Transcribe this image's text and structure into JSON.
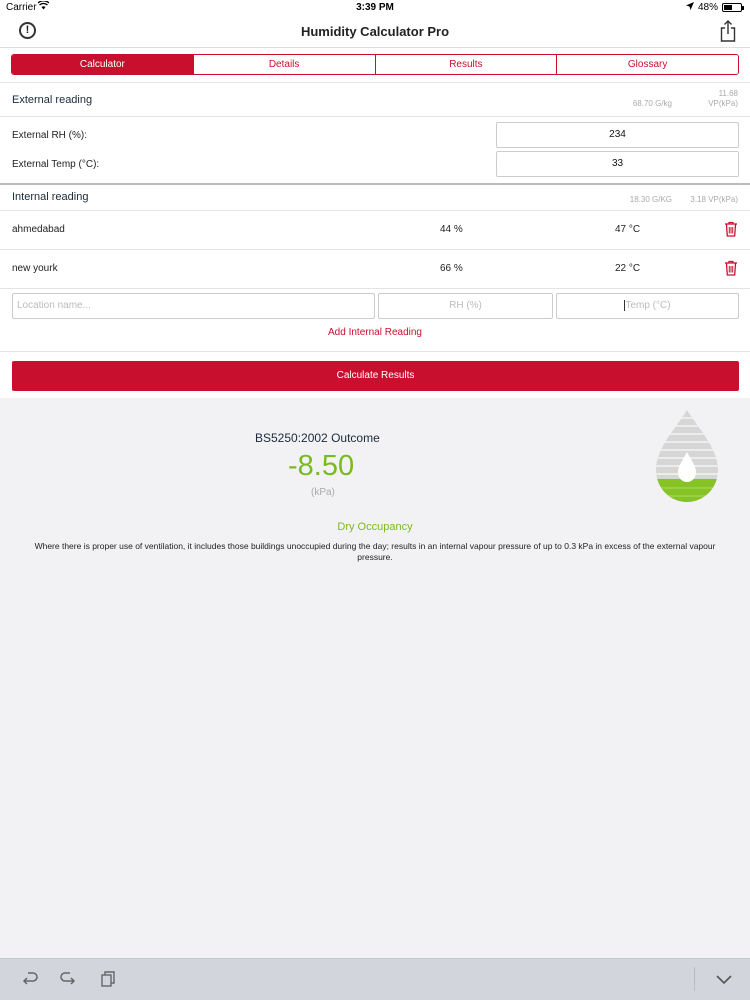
{
  "status_bar": {
    "carrier": "Carrier",
    "time": "3:39 PM",
    "battery": "48%",
    "battery_level": 0.48
  },
  "nav": {
    "title": "Humidity Calculator Pro",
    "info_icon": "info-icon",
    "share_icon": "share-icon"
  },
  "tabs": [
    {
      "label": "Calculator",
      "active": true
    },
    {
      "label": "Details",
      "active": false
    },
    {
      "label": "Results",
      "active": false
    },
    {
      "label": "Glossary",
      "active": false
    }
  ],
  "external": {
    "heading": "External reading",
    "gkg": "68.70 G/kg",
    "vp_value": "11.68",
    "vp_unit": "VP(kPa)",
    "rh_label": "External RH (%):",
    "rh_value": "234",
    "temp_label": "External Temp (°C):",
    "temp_value": "33"
  },
  "internal": {
    "heading": "Internal reading",
    "gkg": "18.30 G/KG",
    "vp": "3.18 VP(kPa)",
    "readings": [
      {
        "location": "ahmedabad",
        "rh": "44 %",
        "temp": "47 °C"
      },
      {
        "location": "new yourk",
        "rh": "66 %",
        "temp": "22 °C"
      }
    ],
    "location_placeholder": "Location name...",
    "rh_placeholder": "RH (%)",
    "temp_placeholder": "Temp (°C)",
    "add_label": "Add Internal Reading"
  },
  "calculate_label": "Calculate Results",
  "outcome": {
    "heading": "BS5250:2002 Outcome",
    "value": "-8.50",
    "unit": "(kPa)",
    "occupancy": "Dry Occupancy",
    "description": "Where there is proper use of ventilation, it includes those buildings unoccupied during the day; results in an internal vapour pressure of up to 0.3 kPa in excess of the external vapour pressure.",
    "drop_fill_level": 0.25,
    "accent_color": "#79bb1f"
  },
  "colors": {
    "brand": "#c8102e",
    "success": "#79bb1f"
  },
  "toolbar": {
    "icons": [
      "undo-icon",
      "redo-icon",
      "clipboard-icon",
      "chevron-down-icon"
    ]
  }
}
